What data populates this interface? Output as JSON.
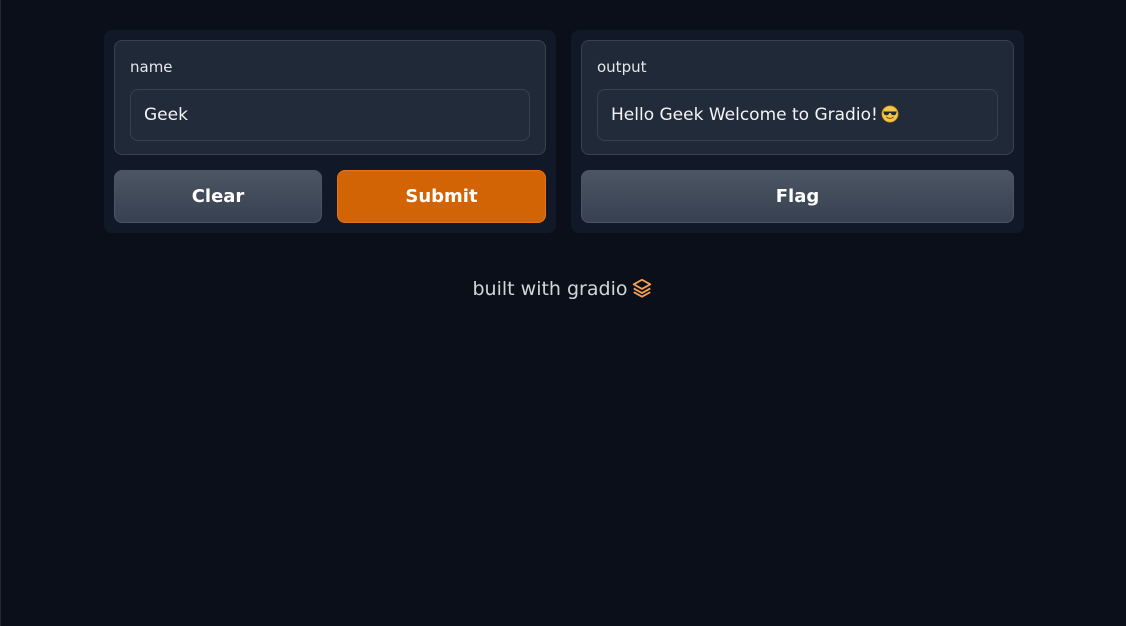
{
  "input_panel": {
    "label": "name",
    "value": "Geek",
    "clear_label": "Clear",
    "submit_label": "Submit"
  },
  "output_panel": {
    "label": "output",
    "value": "Hello Geek Welcome to Gradio!",
    "value_emoji": "smiling-face-with-sunglasses-icon",
    "flag_label": "Flag"
  },
  "footer": {
    "text": "built with gradio",
    "logo_icon": "gradio-logo-icon"
  },
  "colors": {
    "background": "#0b0f19",
    "panel": "#111827",
    "field": "#1f2937",
    "primary_button": "#d26405",
    "secondary_button": "#4b5563",
    "logo": "#f59e52"
  }
}
